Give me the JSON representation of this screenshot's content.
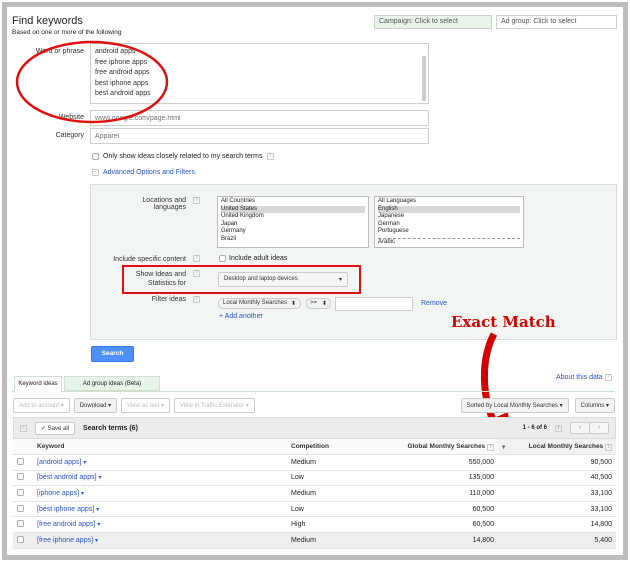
{
  "header": {
    "title": "Find keywords",
    "subtitle": "Based on one or more of the following",
    "campaign": "Campaign: Click to select",
    "ad_group": "Ad group: Click to select"
  },
  "form": {
    "word_label": "Word or phrase",
    "words": [
      "android apps",
      "free iphone apps",
      "free android apps",
      "best iphone apps",
      "best android apps"
    ],
    "website_label": "Website",
    "website_placeholder": "www.google.com/page.html",
    "category_label": "Category",
    "category_placeholder": "Apparel",
    "only_show": "Only show ideas closely related to my search terms",
    "advanced": "Advanced Options and Filters"
  },
  "advanced": {
    "locations_label": "Locations and languages",
    "locations": [
      "All Countries",
      "United States",
      "United Kingdom",
      "Japan",
      "Germany",
      "Brazil"
    ],
    "languages": [
      "All Languages",
      "English",
      "Japanese",
      "German",
      "Portuguese",
      "Arabic"
    ],
    "include_label": "Include specific content",
    "include_adult": "Include adult ideas",
    "show_label": "Show Ideas and Statistics for",
    "device": "Desktop and laptop devices",
    "filter_label": "Filter ideas",
    "filter_field": "Local Monthly Searches",
    "filter_op": ">=",
    "remove": "Remove",
    "add_another": "+ Add another"
  },
  "search_button": "Search",
  "annotation": "Exact Match",
  "tabs": [
    "Keyword ideas",
    "Ad group ideas (Beta)"
  ],
  "about": "About this data",
  "toolbar": {
    "add": "Add to account",
    "download": "Download",
    "view_text": "View as text",
    "traffic": "View in Traffic Estimator",
    "sorted": "Sorted by Local Monthly Searches",
    "columns": "Columns"
  },
  "results": {
    "save_all": "✓ Save all",
    "title": "Search terms (6)",
    "pager": "1 - 6 of 6",
    "columns": [
      "Keyword",
      "Competition",
      "Global Monthly Searches",
      "Local Monthly Searches"
    ],
    "rows": [
      {
        "keyword": "[android apps]",
        "competition": "Medium",
        "global": "550,000",
        "local": "90,500"
      },
      {
        "keyword": "[best android apps]",
        "competition": "Low",
        "global": "135,000",
        "local": "40,500"
      },
      {
        "keyword": "[iphone apps]",
        "competition": "Medium",
        "global": "110,000",
        "local": "33,100"
      },
      {
        "keyword": "[best iphone apps]",
        "competition": "Low",
        "global": "60,500",
        "local": "33,100"
      },
      {
        "keyword": "[free android apps]",
        "competition": "High",
        "global": "60,500",
        "local": "14,800"
      },
      {
        "keyword": "[free iphone apps]",
        "competition": "Medium",
        "global": "14,800",
        "local": "5,400"
      }
    ]
  }
}
